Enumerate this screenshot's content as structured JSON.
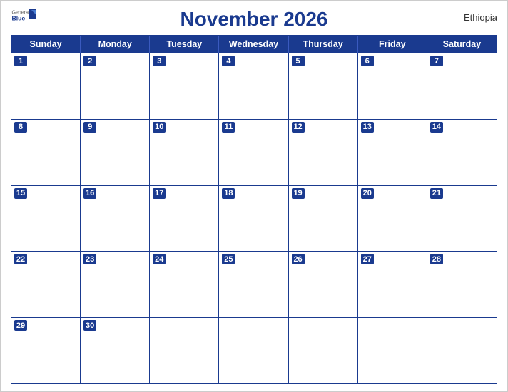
{
  "header": {
    "logo_general": "General",
    "logo_blue": "Blue",
    "title": "November 2026",
    "country": "Ethiopia"
  },
  "days_of_week": [
    "Sunday",
    "Monday",
    "Tuesday",
    "Wednesday",
    "Thursday",
    "Friday",
    "Saturday"
  ],
  "weeks": [
    [
      {
        "date": "1",
        "has_date": true
      },
      {
        "date": "2",
        "has_date": true
      },
      {
        "date": "3",
        "has_date": true
      },
      {
        "date": "4",
        "has_date": true
      },
      {
        "date": "5",
        "has_date": true
      },
      {
        "date": "6",
        "has_date": true
      },
      {
        "date": "7",
        "has_date": true
      }
    ],
    [
      {
        "date": "8",
        "has_date": true
      },
      {
        "date": "9",
        "has_date": true
      },
      {
        "date": "10",
        "has_date": true
      },
      {
        "date": "11",
        "has_date": true
      },
      {
        "date": "12",
        "has_date": true
      },
      {
        "date": "13",
        "has_date": true
      },
      {
        "date": "14",
        "has_date": true
      }
    ],
    [
      {
        "date": "15",
        "has_date": true
      },
      {
        "date": "16",
        "has_date": true
      },
      {
        "date": "17",
        "has_date": true
      },
      {
        "date": "18",
        "has_date": true
      },
      {
        "date": "19",
        "has_date": true
      },
      {
        "date": "20",
        "has_date": true
      },
      {
        "date": "21",
        "has_date": true
      }
    ],
    [
      {
        "date": "22",
        "has_date": true
      },
      {
        "date": "23",
        "has_date": true
      },
      {
        "date": "24",
        "has_date": true
      },
      {
        "date": "25",
        "has_date": true
      },
      {
        "date": "26",
        "has_date": true
      },
      {
        "date": "27",
        "has_date": true
      },
      {
        "date": "28",
        "has_date": true
      }
    ],
    [
      {
        "date": "29",
        "has_date": true
      },
      {
        "date": "30",
        "has_date": true
      },
      {
        "date": "",
        "has_date": false
      },
      {
        "date": "",
        "has_date": false
      },
      {
        "date": "",
        "has_date": false
      },
      {
        "date": "",
        "has_date": false
      },
      {
        "date": "",
        "has_date": false
      }
    ]
  ],
  "colors": {
    "header_bg": "#1a3a8f",
    "text_white": "#ffffff",
    "border": "#1a3a8f"
  }
}
